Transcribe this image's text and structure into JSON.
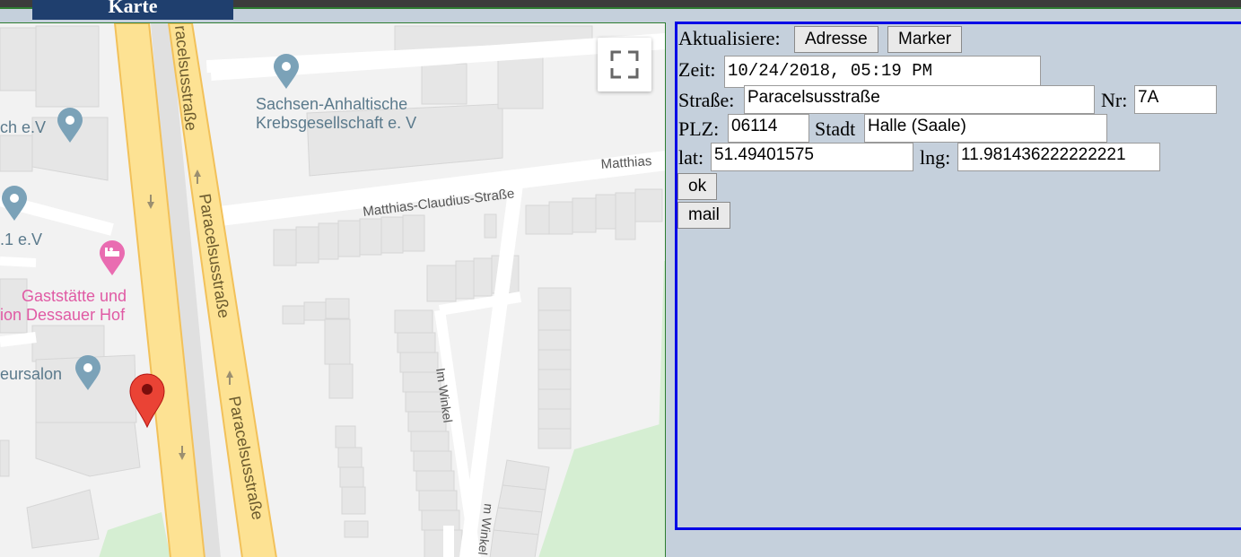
{
  "header": {
    "tab_label": "Karte"
  },
  "map": {
    "labels": {
      "krebs1": "Sachsen-Anhaltische",
      "krebs2": "Krebsgesellschaft e. V",
      "ch_ev": "ch e.V",
      "one_ev": ".1 e.V",
      "gast1": "Gaststätte und",
      "gast2": "ion Dessauer Hof",
      "eursalon": "eursalon",
      "street_paracels_top": "racelsusstraße",
      "street_paracels_mid": "Paracelsusstraße",
      "street_paracels_bot": "Paracelsusstraße",
      "street_matthias": "Matthias-Claudius-Straße",
      "street_matthias_right": "Matthias",
      "street_imwinkel": "Im Winkel",
      "street_imwinkel2": "m Winkel"
    }
  },
  "panel": {
    "aktualisiere_label": "Aktualisiere:",
    "adresse_button": "Adresse",
    "marker_button": "Marker",
    "zeit_label": "Zeit:",
    "zeit_value": "10/24/2018, 05:19 PM",
    "strasse_label": "Straße:",
    "strasse_value": "Paracelsusstraße",
    "nr_label": "Nr:",
    "nr_value": "7A",
    "plz_label": "PLZ:",
    "plz_value": "06114",
    "stadt_label": "Stadt",
    "stadt_value": "Halle (Saale)",
    "lat_label": "lat:",
    "lat_value": "51.49401575",
    "lng_label": "lng:",
    "lng_value": "11.981436222222221",
    "ok_button": "ok",
    "mail_button": "mail"
  },
  "colors": {
    "panel_border": "#0000e6",
    "panel_bg": "#c5d0dc",
    "road_major": "#fde293",
    "poi_pin": "#7ba2b8",
    "hotel_pin": "#e96cb1",
    "marker": "#ea4335"
  }
}
